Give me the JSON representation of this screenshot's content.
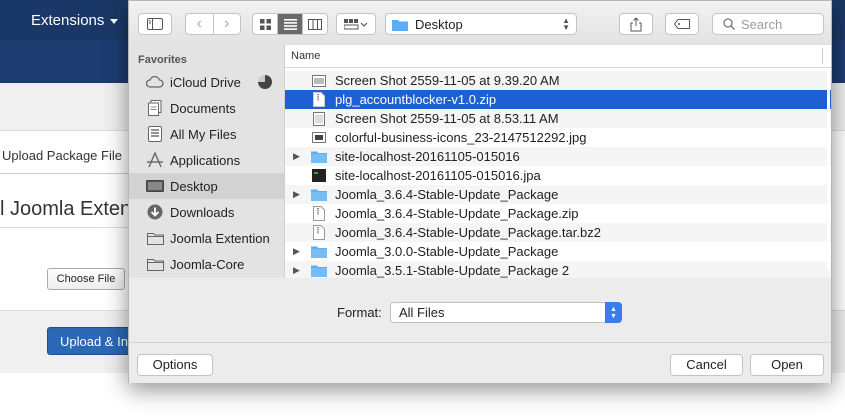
{
  "background": {
    "nav_menu": "Extensions",
    "tab_label": "Upload Package File",
    "heading": "l Joomla Exten",
    "choose_button": "Choose File",
    "upload_button": "Upload & In"
  },
  "toolbar": {
    "location": "Desktop",
    "search_placeholder": "Search"
  },
  "sidebar": {
    "heading": "Favorites",
    "items": [
      {
        "label": "iCloud Drive",
        "icon": "cloud-icon"
      },
      {
        "label": "Documents",
        "icon": "documents-icon"
      },
      {
        "label": "All My Files",
        "icon": "all-files-icon"
      },
      {
        "label": "Applications",
        "icon": "applications-icon"
      },
      {
        "label": "Desktop",
        "icon": "desktop-icon",
        "selected": true
      },
      {
        "label": "Downloads",
        "icon": "downloads-icon"
      },
      {
        "label": "Joomla Extention",
        "icon": "folder-icon"
      },
      {
        "label": "Joomla-Core",
        "icon": "folder-icon"
      }
    ]
  },
  "file_list": {
    "column_name": "Name",
    "rows": [
      {
        "name": "Screen Shot 2559-11-05 at 9.39.20 AM",
        "icon": "screenshot-icon"
      },
      {
        "name": "plg_accountblocker-v1.0.zip",
        "icon": "zip-icon",
        "selected": true
      },
      {
        "name": "Screen Shot 2559-11-05 at 8.53.11 AM",
        "icon": "screenshot-icon"
      },
      {
        "name": "colorful-business-icons_23-2147512292.jpg",
        "icon": "image-icon"
      },
      {
        "name": "site-localhost-20161105-015016",
        "icon": "folder-icon",
        "folder": true
      },
      {
        "name": "site-localhost-20161105-015016.jpa",
        "icon": "archive-icon"
      },
      {
        "name": "Joomla_3.6.4-Stable-Update_Package",
        "icon": "folder-icon",
        "folder": true
      },
      {
        "name": "Joomla_3.6.4-Stable-Update_Package.zip",
        "icon": "zip-icon"
      },
      {
        "name": "Joomla_3.6.4-Stable-Update_Package.tar.bz2",
        "icon": "zip-icon"
      },
      {
        "name": "Joomla_3.0.0-Stable-Update_Package",
        "icon": "folder-icon",
        "folder": true
      },
      {
        "name": "Joomla_3.5.1-Stable-Update_Package 2",
        "icon": "folder-icon",
        "folder": true
      }
    ]
  },
  "format": {
    "label": "Format:",
    "value": "All Files"
  },
  "buttons": {
    "options": "Options",
    "cancel": "Cancel",
    "open": "Open"
  },
  "colors": {
    "selection": "#1f5fd4",
    "nav_bg": "#1a3867",
    "folder": "#5aaef3"
  }
}
